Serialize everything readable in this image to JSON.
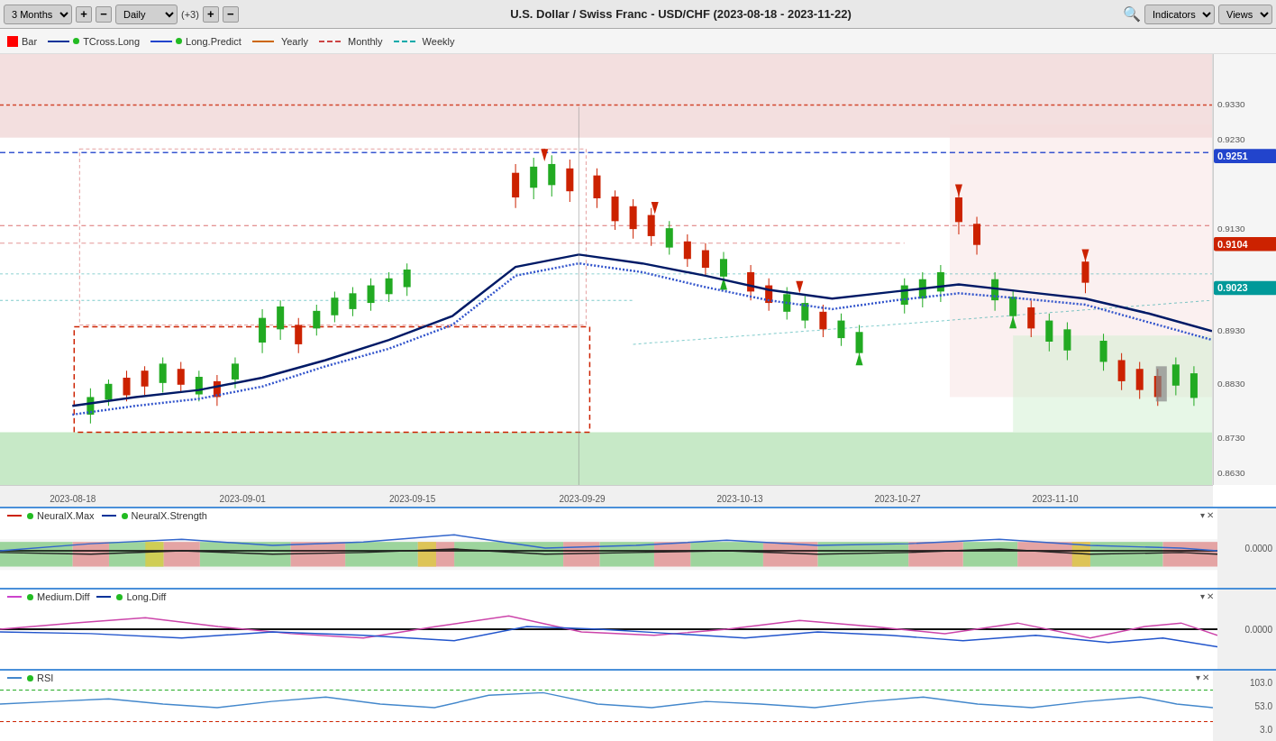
{
  "toolbar": {
    "timeframe_label": "3 Months",
    "period_label": "Daily",
    "period_offset": "(+3)",
    "title": "U.S. Dollar / Swiss Franc - USD/CHF (2023-08-18 - 2023-11-22)",
    "indicators_label": "Indicators",
    "views_label": "Views"
  },
  "legend": {
    "bar_label": "Bar",
    "tcross_label": "TCross.Long",
    "long_predict_label": "Long.Predict",
    "yearly_label": "Yearly",
    "monthly_label": "Monthly",
    "weekly_label": "Weekly"
  },
  "price_axis": {
    "levels": [
      0.933,
      0.9251,
      0.923,
      0.913,
      0.9104,
      0.9023,
      0.893,
      0.883,
      0.873,
      0.863
    ],
    "highlighted": {
      "p9251": {
        "value": "0.9251",
        "color": "#3355ff"
      },
      "p9104": {
        "value": "0.9104",
        "color": "#cc2200"
      },
      "p9023": {
        "value": "0.9023",
        "color": "#00aaaa"
      }
    }
  },
  "x_axis": {
    "labels": [
      "2023-08-18",
      "2023-09-01",
      "2023-09-15",
      "2023-09-29",
      "2023-10-13",
      "2023-10-27",
      "2023-11-10"
    ]
  },
  "sub_panels": {
    "neural": {
      "title1": "NeuralX.Max",
      "title2": "NeuralX.Strength",
      "value": "0.0000"
    },
    "diff": {
      "title1": "Medium.Diff",
      "title2": "Long.Diff",
      "value": "0.0000"
    },
    "rsi": {
      "title": "RSI",
      "levels": [
        "103.0",
        "53.0",
        "3.0"
      ]
    }
  },
  "colors": {
    "accent_blue": "#3355ff",
    "accent_teal": "#00aaaa",
    "accent_red": "#cc2200",
    "green_candle": "#22aa22",
    "red_candle": "#cc2200",
    "bull_bg": "#e8f5e9",
    "bear_bg": "#fce4e4"
  }
}
